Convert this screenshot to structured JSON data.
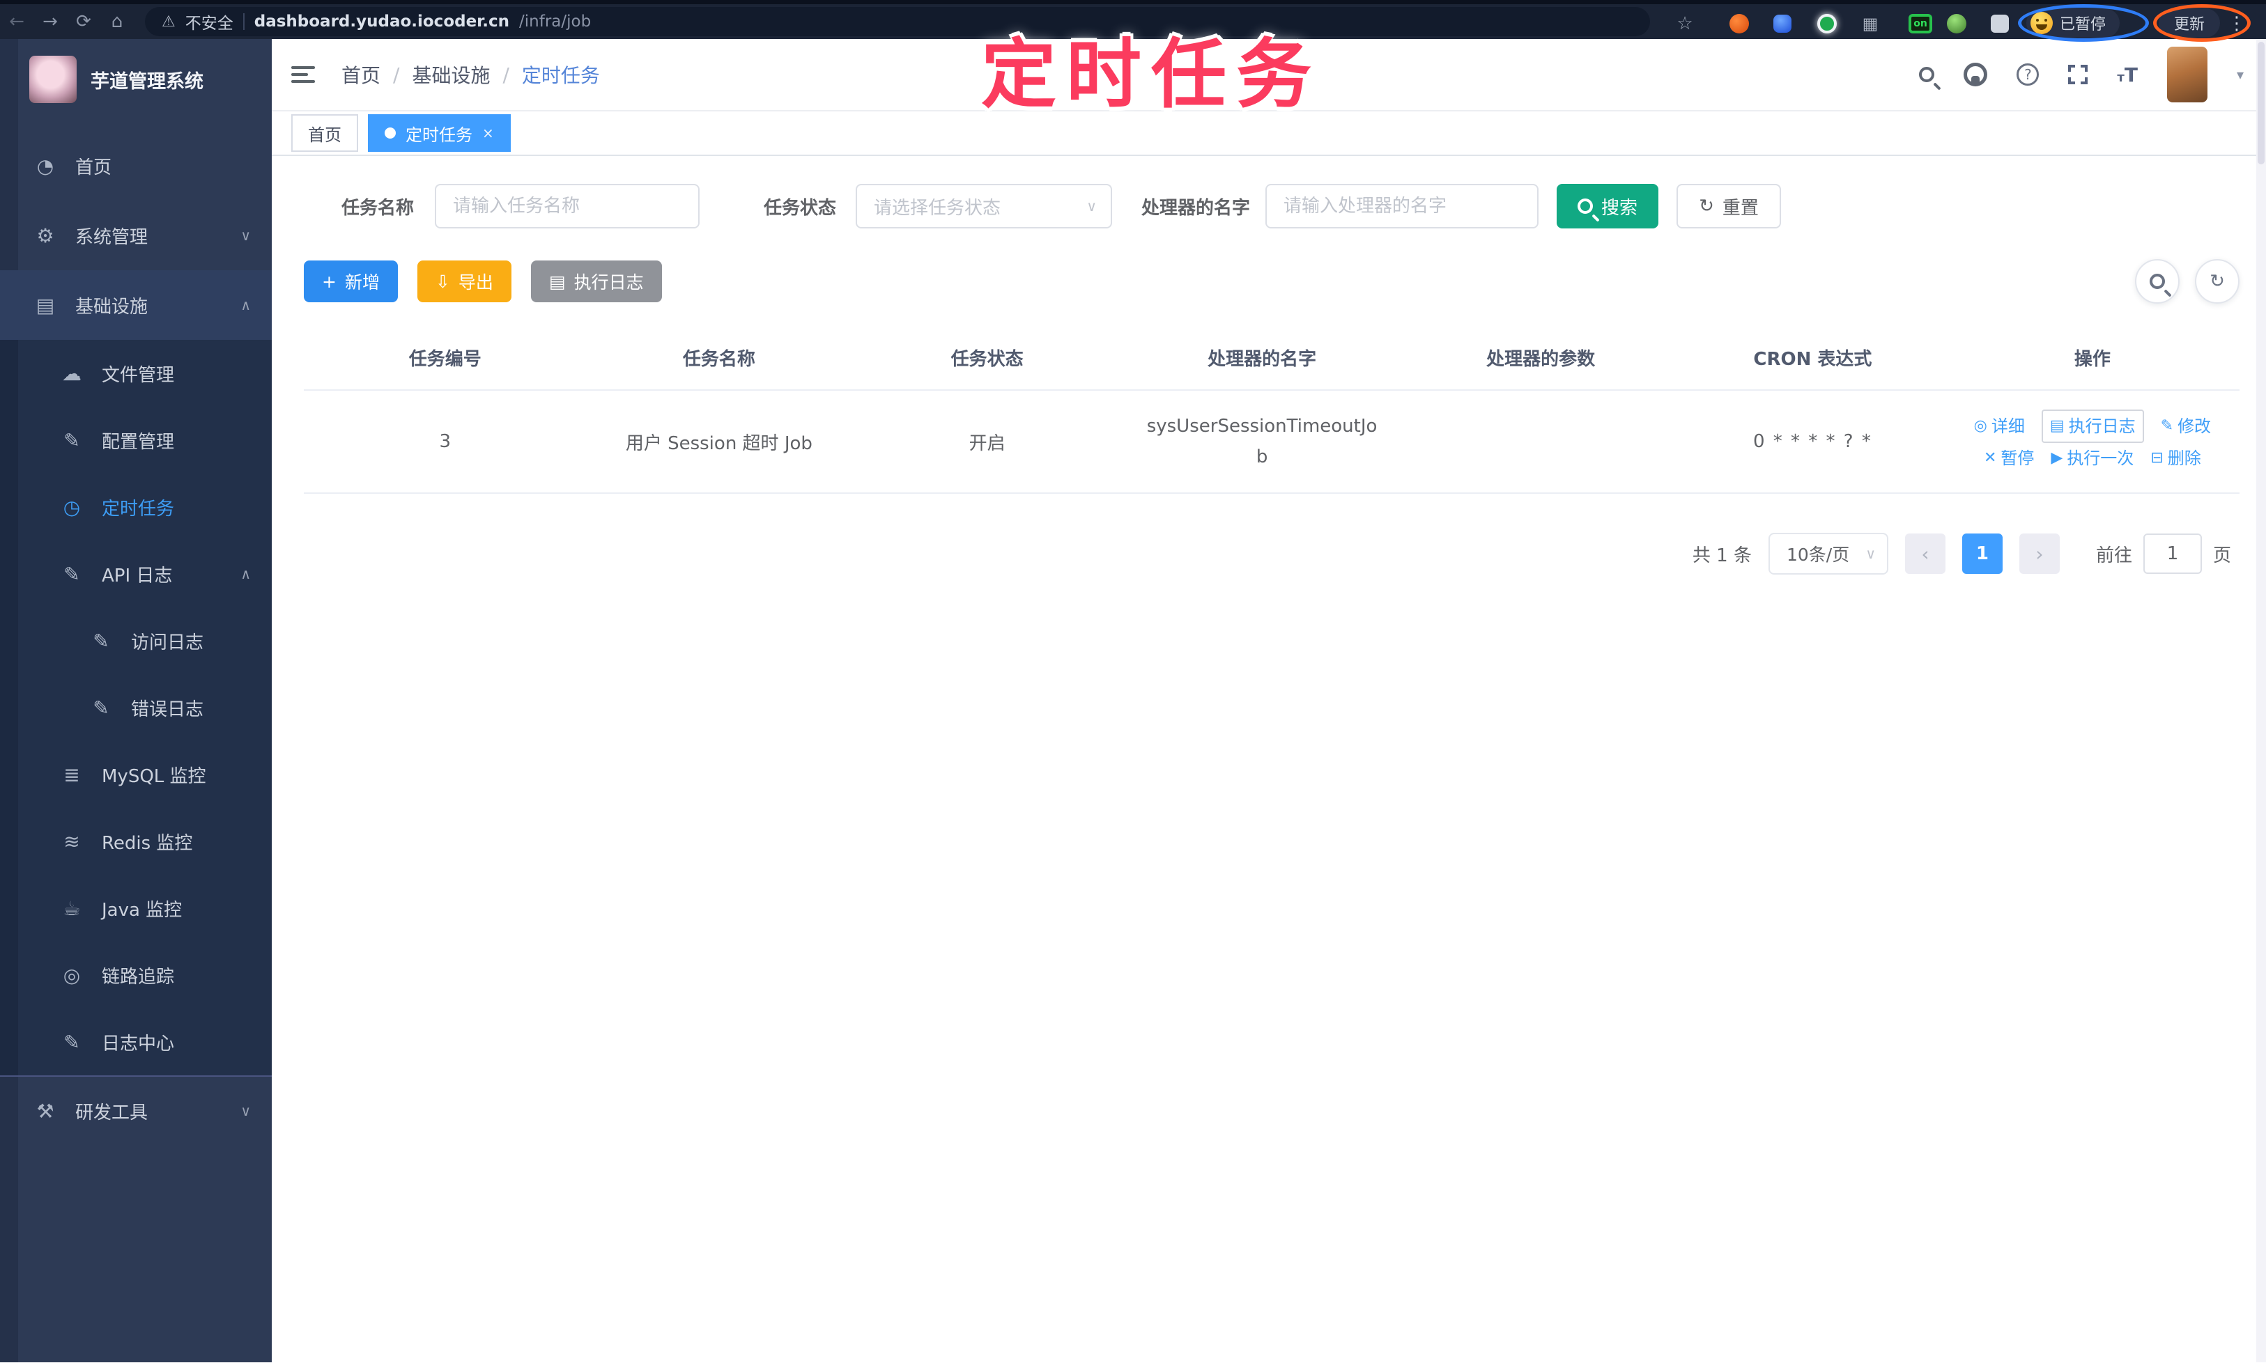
{
  "browser": {
    "security_label": "不安全",
    "url_host": "dashboard.yudao.iocoder.cn",
    "url_path": "/infra/job",
    "on_badge": "on",
    "paused_label": "已暂停",
    "update_label": "更新"
  },
  "icons": {
    "back": "←",
    "forward": "→",
    "reload": "⟳",
    "home": "⌂",
    "warning": "⚠",
    "star": "☆",
    "grid": "▦",
    "kebab": "⋮",
    "caret": "▾",
    "chevron_up": "∧",
    "chevron_down": "∨",
    "select_chevron": "∨",
    "refresh": "↻",
    "prev": "‹",
    "next": "›"
  },
  "annotation": {
    "text": "定时任务"
  },
  "sidebar": {
    "app_title": "芋道管理系统",
    "items": [
      {
        "label": "首页",
        "glyph": "◔"
      },
      {
        "label": "系统管理",
        "glyph": "⚙",
        "chevron": "∨"
      },
      {
        "label": "基础设施",
        "glyph": "▤",
        "chevron": "∧"
      },
      {
        "label": "文件管理",
        "glyph": "☁"
      },
      {
        "label": "配置管理",
        "glyph": "✎"
      },
      {
        "label": "定时任务",
        "glyph": "◷"
      },
      {
        "label": "API 日志",
        "glyph": "✎",
        "chevron": "∧"
      },
      {
        "label": "访问日志",
        "glyph": "✎"
      },
      {
        "label": "错误日志",
        "glyph": "✎"
      },
      {
        "label": "MySQL 监控",
        "glyph": "≣"
      },
      {
        "label": "Redis 监控",
        "glyph": "≋"
      },
      {
        "label": "Java 监控",
        "glyph": "☕"
      },
      {
        "label": "链路追踪",
        "glyph": "◎"
      },
      {
        "label": "日志中心",
        "glyph": "✎"
      },
      {
        "label": "研发工具",
        "glyph": "⚒",
        "chevron": "∨"
      }
    ]
  },
  "topbar": {
    "breadcrumb": [
      "首页",
      "基础设施",
      "定时任务"
    ],
    "separator": "/"
  },
  "tabs": [
    {
      "label": "首页"
    },
    {
      "label": "定时任务",
      "close": "×"
    }
  ],
  "filters": {
    "name_label": "任务名称",
    "name_placeholder": "请输入任务名称",
    "status_label": "任务状态",
    "status_placeholder": "请选择任务状态",
    "handler_label": "处理器的名字",
    "handler_placeholder": "请输入处理器的名字",
    "search_label": "搜索",
    "reset_label": "重置"
  },
  "toolbar": {
    "add_icon": "+",
    "add_label": "新增",
    "export_icon": "⇩",
    "export_label": "导出",
    "exec_log_icon": "▤",
    "exec_log_label": "执行日志"
  },
  "table": {
    "columns": [
      "任务编号",
      "任务名称",
      "任务状态",
      "处理器的名字",
      "处理器的参数",
      "CRON 表达式",
      "操作"
    ],
    "rows": [
      {
        "id": "3",
        "name": "用户 Session 超时 Job",
        "status": "开启",
        "handler": "sysUserSessionTimeoutJob",
        "param": "",
        "cron": "0 * * * * ? *"
      }
    ],
    "actions": [
      {
        "icon": "◎",
        "label": "详细"
      },
      {
        "icon": "▤",
        "label": "执行日志"
      },
      {
        "icon": "✎",
        "label": "修改"
      },
      {
        "icon": "✕",
        "label": "暂停"
      },
      {
        "icon": "▶",
        "label": "执行一次"
      },
      {
        "icon": "⊟",
        "label": "删除"
      }
    ]
  },
  "pagination": {
    "total": "共 1 条",
    "page_size": "10条/页",
    "current": "1",
    "goto_label": "前往",
    "goto_value": "1",
    "unit": "页"
  },
  "colors": {
    "accent_blue": "#409eff",
    "search_teal": "#11a983",
    "export_orange": "#faad14",
    "gray_button": "#909399",
    "sidebar_bg": "#2d3a55",
    "submenu_bg": "#22304a",
    "annotation_pink": "#fb3b5e"
  }
}
